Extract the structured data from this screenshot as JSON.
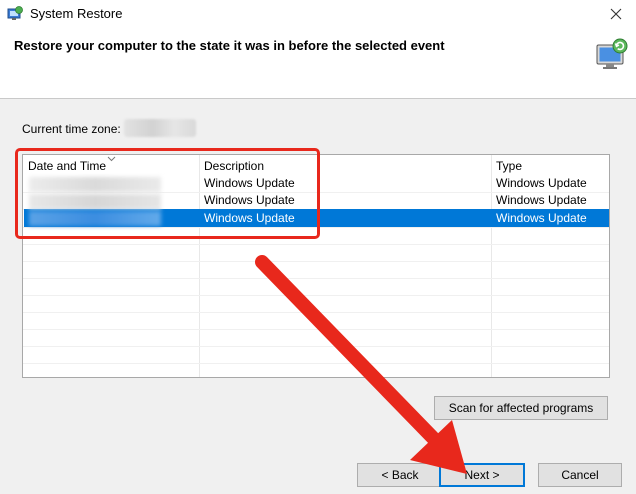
{
  "window": {
    "title": "System Restore"
  },
  "header": {
    "heading": "Restore your computer to the state it was in before the selected event"
  },
  "timezone": {
    "label": "Current time zone:"
  },
  "table": {
    "columns": [
      "Date and Time",
      "Description",
      "Type"
    ],
    "rows": [
      {
        "description": "Windows Update",
        "type": "Windows Update"
      },
      {
        "description": "Windows Update",
        "type": "Windows Update"
      },
      {
        "description": "Windows Update",
        "type": "Windows Update"
      }
    ],
    "selected_row": 3
  },
  "buttons": {
    "scan": "Scan for affected programs",
    "back": "< Back",
    "next": "Next >",
    "cancel": "Cancel"
  },
  "colors": {
    "selection": "#0078d7",
    "annotation": "#e8281c"
  },
  "icons": [
    "system-restore-icon",
    "close-icon",
    "sort-indicator-icon",
    "restore-monitor-icon"
  ]
}
